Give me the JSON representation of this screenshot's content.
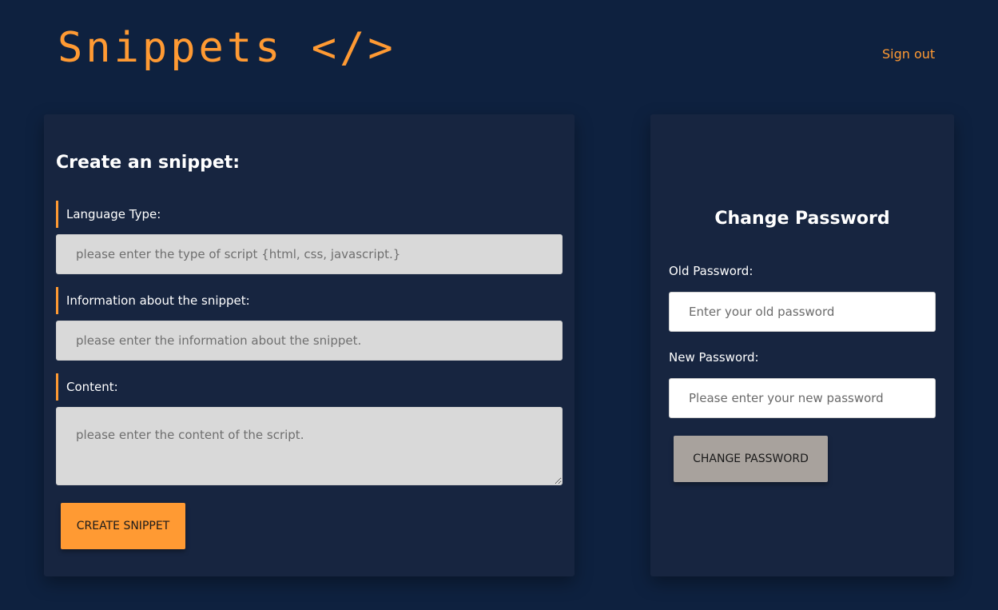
{
  "header": {
    "logo_text": "Snippets </>",
    "signout_label": "Sign out"
  },
  "create_form": {
    "title": "Create an snippet:",
    "language_label": "Language Type:",
    "language_placeholder": "please enter the type of script {html, css, javascript.}",
    "info_label": "Information about the snippet:",
    "info_placeholder": "please enter the information about the snippet.",
    "content_label": "Content:",
    "content_placeholder": "please enter the content of the script.",
    "submit_label": "CREATE SNIPPET"
  },
  "password_form": {
    "title": "Change Password",
    "old_label": "Old Password:",
    "old_placeholder": "Enter your old password",
    "new_label": "New Password:",
    "new_placeholder": "Please enter your new password",
    "submit_label": "CHANGE PASSWORD"
  },
  "colors": {
    "background": "#0e213f",
    "card": "#172540",
    "accent": "#ff9a33",
    "input_gray": "#d9d9d9",
    "button_gray": "#a8a29d"
  }
}
